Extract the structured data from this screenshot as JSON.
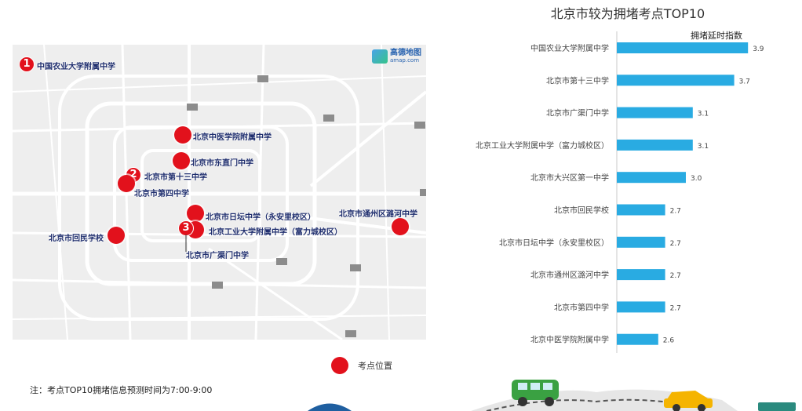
{
  "map": {
    "logo_name": "高德地图",
    "logo_sub": "amap.com",
    "markers": [
      {
        "name": "中国农业大学附属中学",
        "rank": "1"
      },
      {
        "name": "北京中医学院附属中学"
      },
      {
        "name": "北京市东直门中学"
      },
      {
        "name": "北京市第十三中学",
        "rank": "2"
      },
      {
        "name": "北京市第四中学"
      },
      {
        "name": "北京市日坛中学（永安里校区）"
      },
      {
        "name": "北京工业大学附属中学（富力城校区）",
        "rank": "3"
      },
      {
        "name": "北京市广渠门中学"
      },
      {
        "name": "北京市回民学校"
      },
      {
        "name": "北京市通州区潞河中学"
      }
    ]
  },
  "legend": {
    "label": "考点位置",
    "color": "#e2111c"
  },
  "note": "注：考点TOP10拥堵信息预测时间为7:00-9:00",
  "chart_data": {
    "type": "bar",
    "orientation": "horizontal",
    "title": "北京市较为拥堵考点TOP10",
    "series_label": "拥堵延时指数",
    "bar_color": "#29abe2",
    "categories": [
      "中国农业大学附属中学",
      "北京市第十三中学",
      "北京市广渠门中学",
      "北京工业大学附属中学（富力城校区）",
      "北京市大兴区第一中学",
      "北京市回民学校",
      "北京市日坛中学（永安里校区）",
      "北京市通州区潞河中学",
      "北京市第四中学",
      "北京中医学院附属中学"
    ],
    "values": [
      3.9,
      3.7,
      3.1,
      3.1,
      3.0,
      2.7,
      2.7,
      2.7,
      2.7,
      2.6
    ],
    "value_labels": [
      "3.9",
      "3.7",
      "3.1",
      "3.1",
      "3.0",
      "2.7",
      "2.7",
      "2.7",
      "2.7",
      "2.6"
    ],
    "xlim": [
      2.0,
      4.0
    ]
  }
}
